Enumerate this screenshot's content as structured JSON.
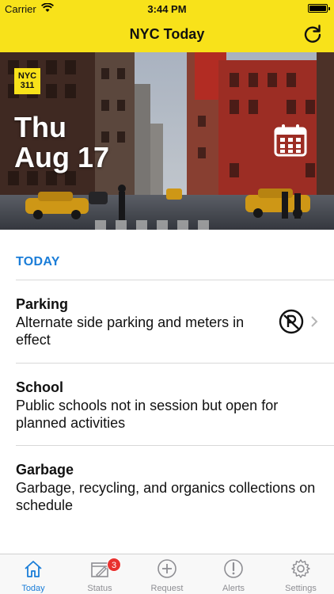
{
  "status_bar": {
    "carrier": "Carrier",
    "time": "3:44 PM"
  },
  "nav": {
    "title": "NYC Today",
    "refresh_icon": "refresh-icon"
  },
  "hero": {
    "logo_line1": "NYC",
    "logo_line2": "311",
    "day": "Thu",
    "month_day": "Aug 17",
    "calendar_icon": "calendar-icon"
  },
  "section": {
    "label": "TODAY"
  },
  "items": [
    {
      "title": "Parking",
      "description": "Alternate side parking and meters in effect",
      "icon": "no-parking-icon"
    },
    {
      "title": "School",
      "description": "Public schools not in session but open for planned activities"
    },
    {
      "title": "Garbage",
      "description": "Garbage, recycling, and organics collections on schedule"
    }
  ],
  "tabs": [
    {
      "label": "Today",
      "icon": "home-icon",
      "active": true
    },
    {
      "label": "Status",
      "icon": "status-icon",
      "badge": "3"
    },
    {
      "label": "Request",
      "icon": "plus-circle-icon"
    },
    {
      "label": "Alerts",
      "icon": "alert-icon"
    },
    {
      "label": "Settings",
      "icon": "gear-icon"
    }
  ],
  "colors": {
    "brand_yellow": "#f8e21a",
    "accent_blue": "#1a7dd8",
    "badge_red": "#e8312f"
  }
}
